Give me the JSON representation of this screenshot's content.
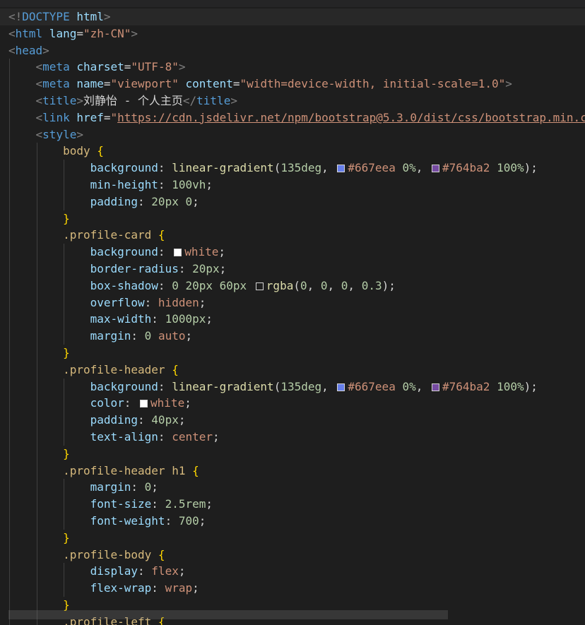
{
  "editor": {
    "lines": [
      {
        "indent": 0,
        "tokens": [
          {
            "c": "br",
            "t": "<!"
          },
          {
            "c": "doctype",
            "t": "DOCTYPE"
          },
          {
            "c": "attr",
            "t": " html"
          },
          {
            "c": "br",
            "t": ">"
          }
        ]
      },
      {
        "indent": 0,
        "tokens": [
          {
            "c": "br",
            "t": "<"
          },
          {
            "c": "tag",
            "t": "html"
          },
          {
            "c": "attr",
            "t": " lang"
          },
          {
            "c": "punc",
            "t": "="
          },
          {
            "c": "str",
            "t": "\"zh-CN\""
          },
          {
            "c": "br",
            "t": ">"
          }
        ]
      },
      {
        "indent": 0,
        "tokens": [
          {
            "c": "br",
            "t": "<"
          },
          {
            "c": "tag",
            "t": "head"
          },
          {
            "c": "br",
            "t": ">"
          }
        ]
      },
      {
        "indent": 1,
        "tokens": [
          {
            "c": "br",
            "t": "<"
          },
          {
            "c": "tag",
            "t": "meta"
          },
          {
            "c": "attr",
            "t": " charset"
          },
          {
            "c": "punc",
            "t": "="
          },
          {
            "c": "str",
            "t": "\"UTF-8\""
          },
          {
            "c": "br",
            "t": ">"
          }
        ]
      },
      {
        "indent": 1,
        "tokens": [
          {
            "c": "br",
            "t": "<"
          },
          {
            "c": "tag",
            "t": "meta"
          },
          {
            "c": "attr",
            "t": " name"
          },
          {
            "c": "punc",
            "t": "="
          },
          {
            "c": "str",
            "t": "\"viewport\""
          },
          {
            "c": "attr",
            "t": " content"
          },
          {
            "c": "punc",
            "t": "="
          },
          {
            "c": "str",
            "t": "\"width=device-width, initial-scale=1.0\""
          },
          {
            "c": "br",
            "t": ">"
          }
        ]
      },
      {
        "indent": 1,
        "tokens": [
          {
            "c": "br",
            "t": "<"
          },
          {
            "c": "tag",
            "t": "title"
          },
          {
            "c": "br",
            "t": ">"
          },
          {
            "c": "text",
            "t": "刘静怡 - 个人主页"
          },
          {
            "c": "br",
            "t": "</"
          },
          {
            "c": "tag",
            "t": "title"
          },
          {
            "c": "br",
            "t": ">"
          }
        ]
      },
      {
        "indent": 1,
        "tokens": [
          {
            "c": "br",
            "t": "<"
          },
          {
            "c": "tag",
            "t": "link"
          },
          {
            "c": "attr",
            "t": " href"
          },
          {
            "c": "punc",
            "t": "="
          },
          {
            "c": "str",
            "t": "\""
          },
          {
            "c": "url",
            "t": "https://cdn.jsdelivr.net/npm/bootstrap@5.3.0/dist/css/bootstrap.min.c"
          }
        ]
      },
      {
        "indent": 1,
        "tokens": [
          {
            "c": "br",
            "t": "<"
          },
          {
            "c": "tag",
            "t": "style"
          },
          {
            "c": "br",
            "t": ">"
          }
        ]
      },
      {
        "indent": 2,
        "tokens": [
          {
            "c": "sel",
            "t": "body"
          },
          {
            "c": "brace",
            "t": " {"
          }
        ]
      },
      {
        "indent": 3,
        "tokens": [
          {
            "c": "prop",
            "t": "background"
          },
          {
            "c": "punc",
            "t": ": "
          },
          {
            "c": "fn",
            "t": "linear-gradient"
          },
          {
            "c": "punc",
            "t": "("
          },
          {
            "c": "num",
            "t": "135deg"
          },
          {
            "c": "punc",
            "t": ", "
          },
          {
            "c": "swatch",
            "t": "#667eea"
          },
          {
            "c": "val",
            "t": "#667eea"
          },
          {
            "c": "punc",
            "t": " "
          },
          {
            "c": "num",
            "t": "0%"
          },
          {
            "c": "punc",
            "t": ", "
          },
          {
            "c": "swatch",
            "t": "#764ba2"
          },
          {
            "c": "val",
            "t": "#764ba2"
          },
          {
            "c": "punc",
            "t": " "
          },
          {
            "c": "num",
            "t": "100%"
          },
          {
            "c": "punc",
            "t": ");"
          }
        ]
      },
      {
        "indent": 3,
        "tokens": [
          {
            "c": "prop",
            "t": "min-height"
          },
          {
            "c": "punc",
            "t": ": "
          },
          {
            "c": "num",
            "t": "100vh"
          },
          {
            "c": "punc",
            "t": ";"
          }
        ]
      },
      {
        "indent": 3,
        "tokens": [
          {
            "c": "prop",
            "t": "padding"
          },
          {
            "c": "punc",
            "t": ": "
          },
          {
            "c": "num",
            "t": "20px 0"
          },
          {
            "c": "punc",
            "t": ";"
          }
        ]
      },
      {
        "indent": 2,
        "tokens": [
          {
            "c": "brace",
            "t": "}"
          }
        ]
      },
      {
        "indent": 2,
        "tokens": [
          {
            "c": "sel",
            "t": ".profile-card"
          },
          {
            "c": "brace",
            "t": " {"
          }
        ]
      },
      {
        "indent": 3,
        "tokens": [
          {
            "c": "prop",
            "t": "background"
          },
          {
            "c": "punc",
            "t": ": "
          },
          {
            "c": "swatch",
            "t": "#ffffff"
          },
          {
            "c": "kw",
            "t": "white"
          },
          {
            "c": "punc",
            "t": ";"
          }
        ]
      },
      {
        "indent": 3,
        "tokens": [
          {
            "c": "prop",
            "t": "border-radius"
          },
          {
            "c": "punc",
            "t": ": "
          },
          {
            "c": "num",
            "t": "20px"
          },
          {
            "c": "punc",
            "t": ";"
          }
        ]
      },
      {
        "indent": 3,
        "tokens": [
          {
            "c": "prop",
            "t": "box-shadow"
          },
          {
            "c": "punc",
            "t": ": "
          },
          {
            "c": "num",
            "t": "0 20px 60px"
          },
          {
            "c": "punc",
            "t": " "
          },
          {
            "c": "swatch",
            "t": "#1e1e1e"
          },
          {
            "c": "fn",
            "t": "rgba"
          },
          {
            "c": "punc",
            "t": "("
          },
          {
            "c": "num",
            "t": "0"
          },
          {
            "c": "punc",
            "t": ", "
          },
          {
            "c": "num",
            "t": "0"
          },
          {
            "c": "punc",
            "t": ", "
          },
          {
            "c": "num",
            "t": "0"
          },
          {
            "c": "punc",
            "t": ", "
          },
          {
            "c": "num",
            "t": "0.3"
          },
          {
            "c": "punc",
            "t": ");"
          }
        ]
      },
      {
        "indent": 3,
        "tokens": [
          {
            "c": "prop",
            "t": "overflow"
          },
          {
            "c": "punc",
            "t": ": "
          },
          {
            "c": "kw",
            "t": "hidden"
          },
          {
            "c": "punc",
            "t": ";"
          }
        ]
      },
      {
        "indent": 3,
        "tokens": [
          {
            "c": "prop",
            "t": "max-width"
          },
          {
            "c": "punc",
            "t": ": "
          },
          {
            "c": "num",
            "t": "1000px"
          },
          {
            "c": "punc",
            "t": ";"
          }
        ]
      },
      {
        "indent": 3,
        "tokens": [
          {
            "c": "prop",
            "t": "margin"
          },
          {
            "c": "punc",
            "t": ": "
          },
          {
            "c": "num",
            "t": "0"
          },
          {
            "c": "punc",
            "t": " "
          },
          {
            "c": "kw",
            "t": "auto"
          },
          {
            "c": "punc",
            "t": ";"
          }
        ]
      },
      {
        "indent": 2,
        "tokens": [
          {
            "c": "brace",
            "t": "}"
          }
        ]
      },
      {
        "indent": 2,
        "tokens": [
          {
            "c": "sel",
            "t": ".profile-header"
          },
          {
            "c": "brace",
            "t": " {"
          }
        ]
      },
      {
        "indent": 3,
        "tokens": [
          {
            "c": "prop",
            "t": "background"
          },
          {
            "c": "punc",
            "t": ": "
          },
          {
            "c": "fn",
            "t": "linear-gradient"
          },
          {
            "c": "punc",
            "t": "("
          },
          {
            "c": "num",
            "t": "135deg"
          },
          {
            "c": "punc",
            "t": ", "
          },
          {
            "c": "swatch",
            "t": "#667eea"
          },
          {
            "c": "val",
            "t": "#667eea"
          },
          {
            "c": "punc",
            "t": " "
          },
          {
            "c": "num",
            "t": "0%"
          },
          {
            "c": "punc",
            "t": ", "
          },
          {
            "c": "swatch",
            "t": "#764ba2"
          },
          {
            "c": "val",
            "t": "#764ba2"
          },
          {
            "c": "punc",
            "t": " "
          },
          {
            "c": "num",
            "t": "100%"
          },
          {
            "c": "punc",
            "t": ");"
          }
        ]
      },
      {
        "indent": 3,
        "tokens": [
          {
            "c": "prop",
            "t": "color"
          },
          {
            "c": "punc",
            "t": ": "
          },
          {
            "c": "swatch",
            "t": "#ffffff"
          },
          {
            "c": "kw",
            "t": "white"
          },
          {
            "c": "punc",
            "t": ";"
          }
        ]
      },
      {
        "indent": 3,
        "tokens": [
          {
            "c": "prop",
            "t": "padding"
          },
          {
            "c": "punc",
            "t": ": "
          },
          {
            "c": "num",
            "t": "40px"
          },
          {
            "c": "punc",
            "t": ";"
          }
        ]
      },
      {
        "indent": 3,
        "tokens": [
          {
            "c": "prop",
            "t": "text-align"
          },
          {
            "c": "punc",
            "t": ": "
          },
          {
            "c": "kw",
            "t": "center"
          },
          {
            "c": "punc",
            "t": ";"
          }
        ]
      },
      {
        "indent": 2,
        "tokens": [
          {
            "c": "brace",
            "t": "}"
          }
        ]
      },
      {
        "indent": 2,
        "tokens": [
          {
            "c": "sel",
            "t": ".profile-header"
          },
          {
            "c": "punc",
            "t": " "
          },
          {
            "c": "sel",
            "t": "h1"
          },
          {
            "c": "brace",
            "t": " {"
          }
        ]
      },
      {
        "indent": 3,
        "tokens": [
          {
            "c": "prop",
            "t": "margin"
          },
          {
            "c": "punc",
            "t": ": "
          },
          {
            "c": "num",
            "t": "0"
          },
          {
            "c": "punc",
            "t": ";"
          }
        ]
      },
      {
        "indent": 3,
        "tokens": [
          {
            "c": "prop",
            "t": "font-size"
          },
          {
            "c": "punc",
            "t": ": "
          },
          {
            "c": "num",
            "t": "2.5rem"
          },
          {
            "c": "punc",
            "t": ";"
          }
        ]
      },
      {
        "indent": 3,
        "tokens": [
          {
            "c": "prop",
            "t": "font-weight"
          },
          {
            "c": "punc",
            "t": ": "
          },
          {
            "c": "num",
            "t": "700"
          },
          {
            "c": "punc",
            "t": ";"
          }
        ]
      },
      {
        "indent": 2,
        "tokens": [
          {
            "c": "brace",
            "t": "}"
          }
        ]
      },
      {
        "indent": 2,
        "tokens": [
          {
            "c": "sel",
            "t": ".profile-body"
          },
          {
            "c": "brace",
            "t": " {"
          }
        ]
      },
      {
        "indent": 3,
        "tokens": [
          {
            "c": "prop",
            "t": "display"
          },
          {
            "c": "punc",
            "t": ": "
          },
          {
            "c": "kw",
            "t": "flex"
          },
          {
            "c": "punc",
            "t": ";"
          }
        ]
      },
      {
        "indent": 3,
        "tokens": [
          {
            "c": "prop",
            "t": "flex-wrap"
          },
          {
            "c": "punc",
            "t": ": "
          },
          {
            "c": "kw",
            "t": "wrap"
          },
          {
            "c": "punc",
            "t": ";"
          }
        ]
      },
      {
        "indent": 2,
        "tokens": [
          {
            "c": "brace",
            "t": "}"
          }
        ]
      },
      {
        "indent": 2,
        "tokens": [
          {
            "c": "sel",
            "t": ".profile-left"
          },
          {
            "c": "brace",
            "t": " {"
          }
        ]
      }
    ]
  },
  "colors": {
    "background": "#1e1e1e",
    "tag": "#569cd6",
    "attribute": "#9cdcfe",
    "string": "#ce9178",
    "selector": "#d7ba7d",
    "number": "#b5cea8",
    "function": "#dcdcaa",
    "brace": "#ffd700"
  }
}
